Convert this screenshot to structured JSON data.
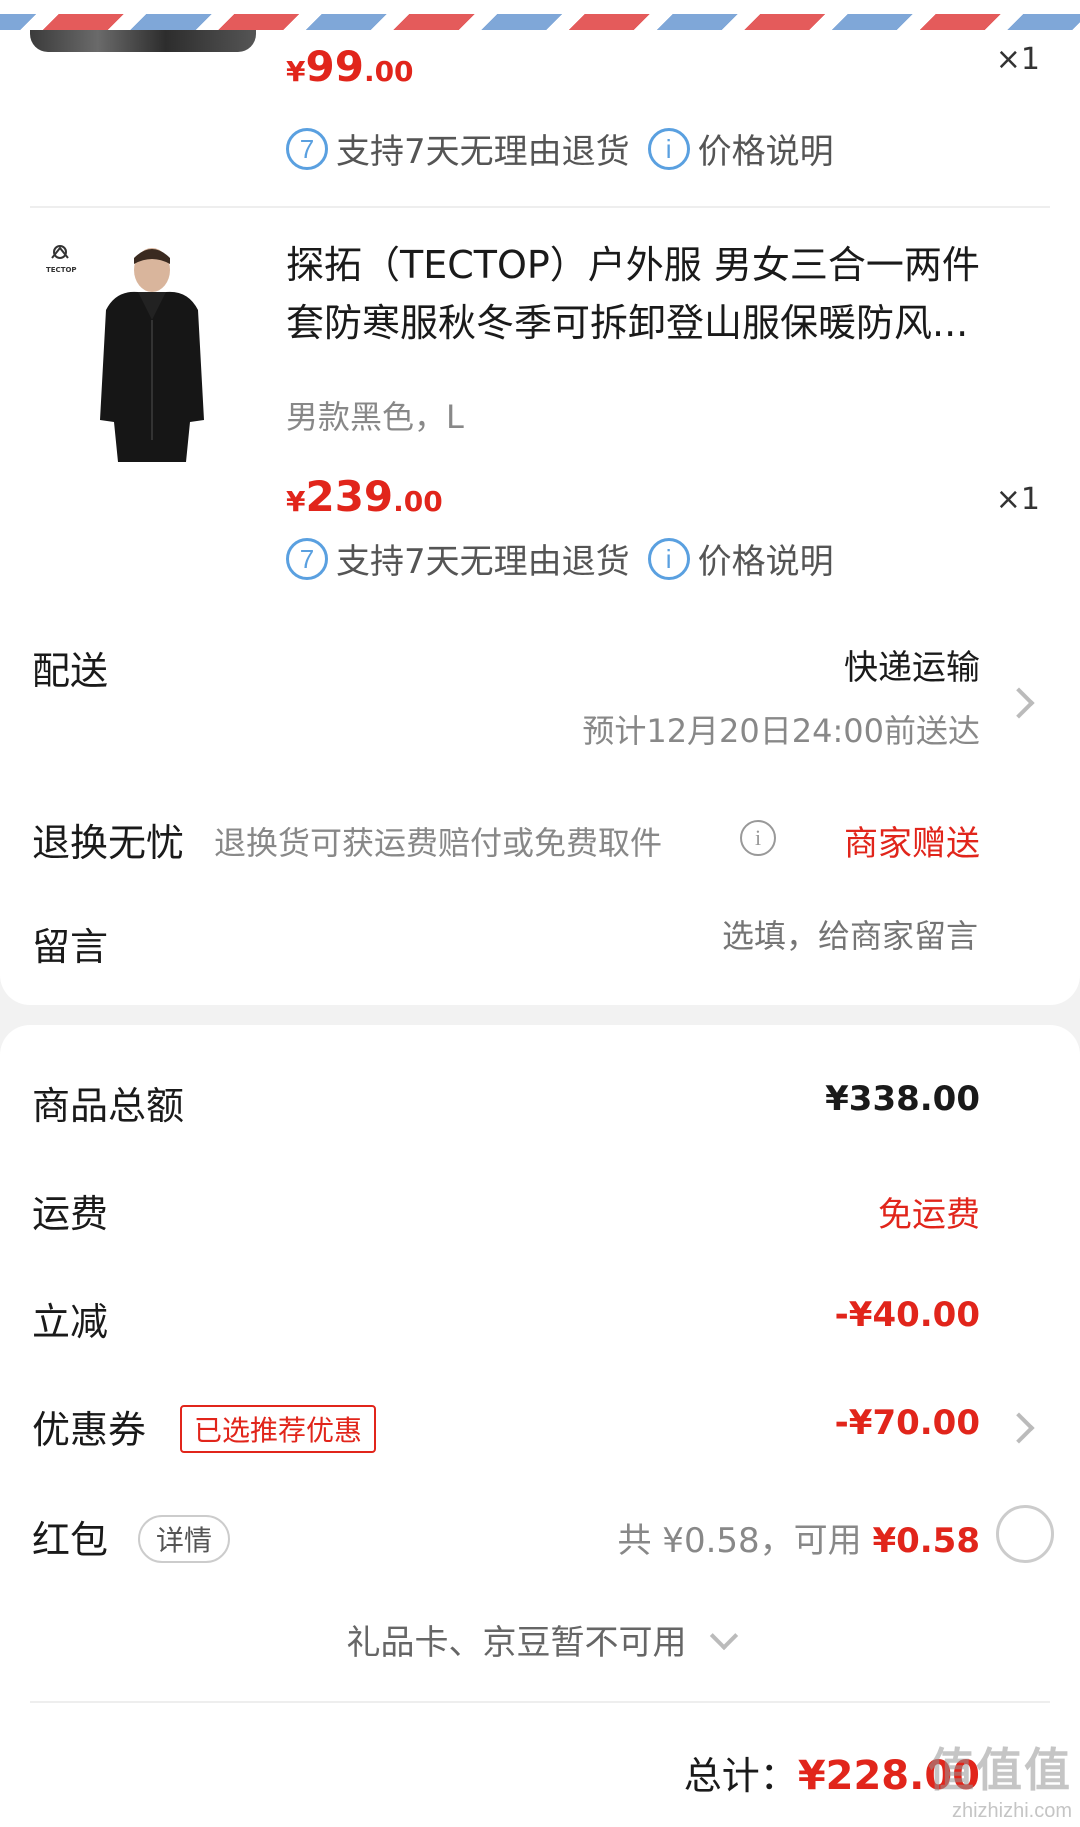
{
  "item1": {
    "price_symbol": "¥",
    "price_int": "99",
    "price_dec": ".00",
    "qty": "×1",
    "return_badge": "7",
    "return_text": "支持7天无理由退货",
    "info_badge": "i",
    "price_info_text": "价格说明"
  },
  "item2": {
    "brand_logo_text": "TECTOP",
    "title_line1": "探拓（TECTOP）户外服 男女三合一两件",
    "title_line2": "套防寒服秋冬季可拆卸登山服保暖防风...",
    "variant": "男款黑色，L",
    "price_symbol": "¥",
    "price_int": "239",
    "price_dec": ".00",
    "qty": "×1",
    "return_badge": "7",
    "return_text": "支持7天无理由退货",
    "info_badge": "i",
    "price_info_text": "价格说明"
  },
  "delivery": {
    "label": "配送",
    "method": "快递运输",
    "eta": "预计12月20日24:00前送达"
  },
  "returns": {
    "label": "退换无忧",
    "desc": "退换货可获运费赔付或免费取件",
    "info_icon": "i",
    "value": "商家赠送"
  },
  "message": {
    "label": "留言",
    "placeholder": "选填，给商家留言"
  },
  "summary": {
    "goods_total_label": "商品总额",
    "goods_total_value": "¥338.00",
    "shipping_label": "运费",
    "shipping_value": "免运费",
    "discount_label": "立减",
    "discount_value": "-¥40.00",
    "coupon_label": "优惠券",
    "coupon_tag": "已选推荐优惠",
    "coupon_value": "-¥70.00",
    "redpacket_label": "红包",
    "redpacket_detail": "详情",
    "redpacket_total": "共 ¥0.58，可用 ",
    "redpacket_available": "¥0.58",
    "giftcard_text": "礼品卡、京豆暂不可用",
    "total_label": "总计：",
    "total_value": "¥228.00"
  },
  "watermark": {
    "logo": "值值值",
    "url": "zhizhizhi.com"
  },
  "colors": {
    "accent_red": "#e1251b",
    "badge_blue": "#5aa0e0"
  }
}
